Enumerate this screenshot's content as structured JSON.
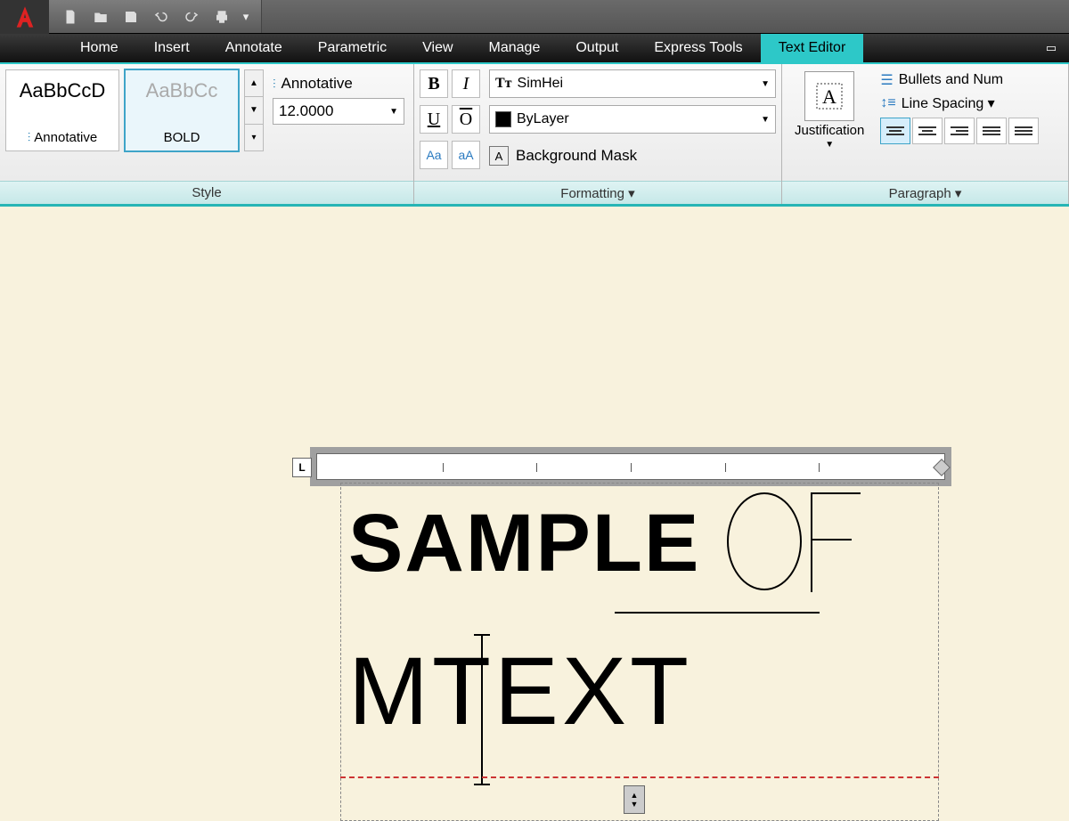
{
  "tabs": [
    "Home",
    "Insert",
    "Annotate",
    "Parametric",
    "View",
    "Manage",
    "Output",
    "Express Tools",
    "Text Editor"
  ],
  "active_tab": "Text Editor",
  "panels": {
    "style": {
      "label": "Style",
      "thumbs": [
        {
          "sample": "AaBbCcD",
          "name": "Annotative"
        },
        {
          "sample": "AaBbCc",
          "name": "BOLD"
        }
      ],
      "annotative_label": "Annotative",
      "height_value": "12.0000"
    },
    "formatting": {
      "label": "Formatting ▾",
      "font": "SimHei",
      "color": "ByLayer",
      "bgmask": "Background Mask",
      "btns": {
        "bold": "B",
        "italic": "I",
        "under": "U",
        "over": "O",
        "caseA": "Aa",
        "caseB": "aA"
      }
    },
    "paragraph": {
      "label": "Paragraph ▾",
      "justification": "Justification",
      "bullets": "Bullets and Num",
      "linespacing": "Line Spacing ▾"
    }
  },
  "mtext": {
    "word1": "SAMPLE",
    "word2_chars": "OF",
    "word3": "MTEXT"
  },
  "ruler": {
    "label": "L"
  }
}
